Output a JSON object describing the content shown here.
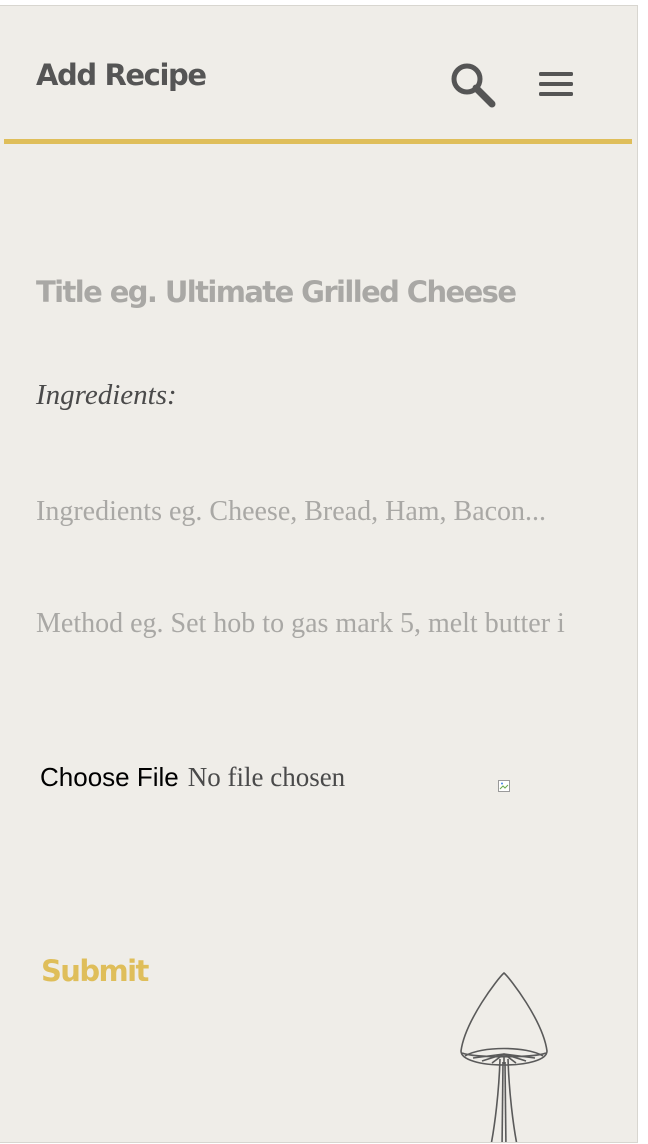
{
  "header": {
    "title": "Add Recipe",
    "accent_color": "#dfbe5a"
  },
  "form": {
    "title_placeholder": "Title eg. Ultimate Grilled Cheese",
    "ingredients_label": "Ingredients:",
    "ingredients_placeholder": "Ingredients eg. Cheese, Bread, Ham, Bacon...",
    "method_placeholder": "Method eg. Set hob to gas mark 5, melt butter i",
    "file_button_label": "Choose File",
    "file_status": "No file chosen",
    "submit_label": "Submit"
  },
  "icons": {
    "search": "search-icon",
    "menu": "hamburger-menu-icon",
    "broken_image": "broken-image-icon",
    "decoration": "mushroom-illustration"
  }
}
